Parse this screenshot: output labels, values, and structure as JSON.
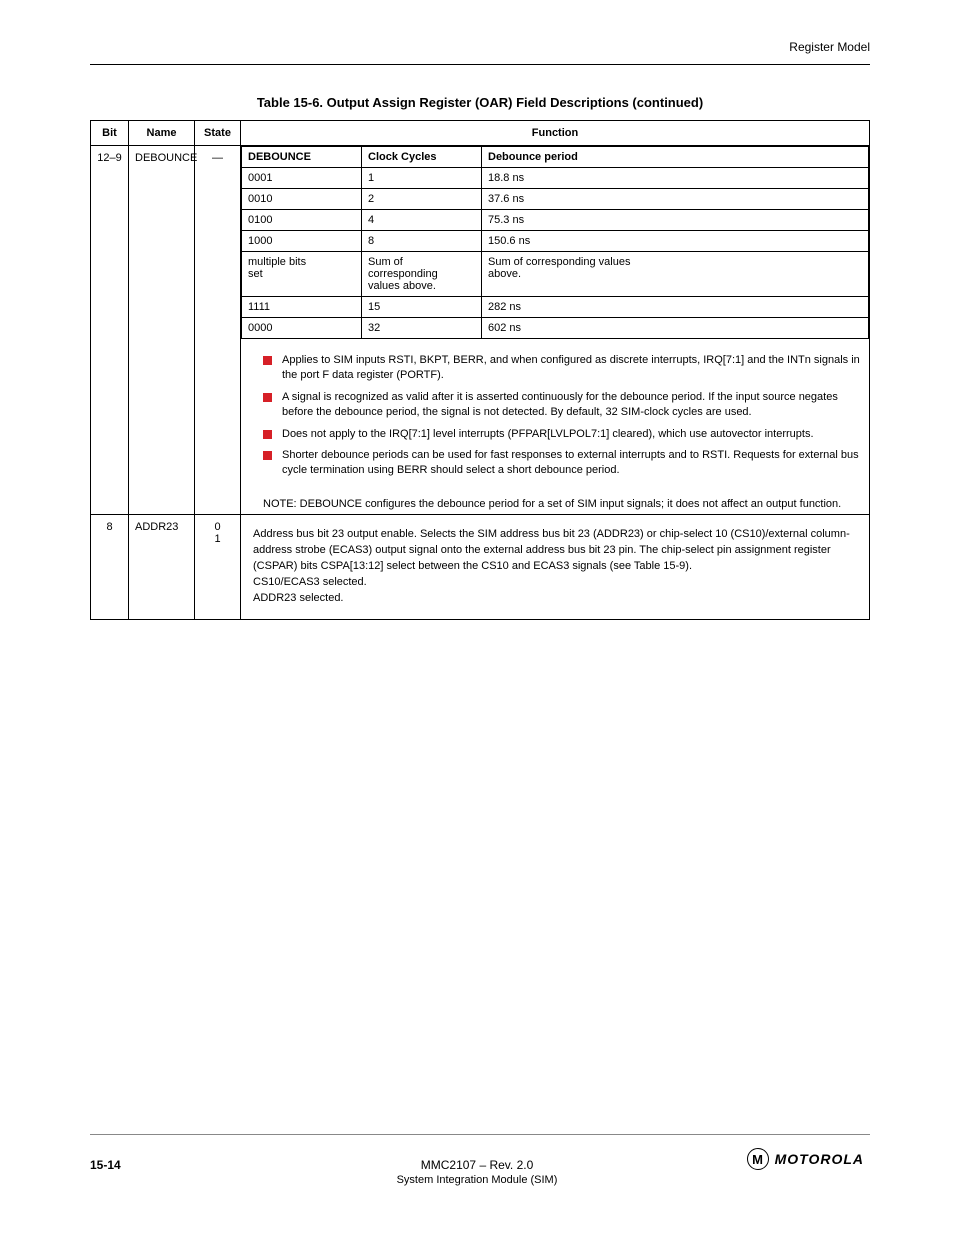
{
  "header": {
    "running": "Register Model"
  },
  "caption": "Table 15-6. Output Assign Register (OAR) Field Descriptions (continued)",
  "columns": {
    "bit": "Bit",
    "name": "Name",
    "state": "State",
    "func": "Function"
  },
  "row1": {
    "bit": "12–9",
    "name": "DEBOUNCE",
    "state": "—",
    "inner": {
      "head": {
        "a": "DEBOUNCE",
        "b": "Clock Cycles",
        "c": "Debounce period"
      },
      "rows": [
        {
          "a": "0001",
          "b": "1",
          "c": "18.8 ns"
        },
        {
          "a": "0010",
          "b": "2",
          "c": "37.6 ns"
        },
        {
          "a": "0100",
          "b": "4",
          "c": "75.3 ns"
        },
        {
          "a": "1000",
          "b": "8",
          "c": "150.6 ns"
        },
        {
          "a": "multiple bits\nset",
          "b": "Sum of\ncorresponding\nvalues above.",
          "c": "Sum of corresponding values\nabove."
        },
        {
          "a": "1111",
          "b": "15",
          "c": "282 ns"
        },
        {
          "a": "0000",
          "b": "32",
          "c": "602 ns"
        }
      ]
    },
    "bullets": [
      "Applies to SIM inputs RSTI, BKPT, BERR, and when configured as discrete interrupts, IRQ[7:1] and the INTn signals in the port F data register (PORTF).",
      "A signal is recognized as valid after it is asserted continuously for the debounce period. If the input source negates before the debounce period, the signal is not detected. By default, 32 SIM-clock cycles are used.",
      "Does not apply to the IRQ[7:1] level interrupts (PFPAR[LVLPOL7:1] cleared), which use autovector interrupts.",
      "Shorter debounce periods can be used for fast responses to external interrupts and to RSTI. Requests for external bus cycle termination using BERR should select a short debounce period."
    ],
    "note": "NOTE: DEBOUNCE configures the debounce period for a set of SIM input signals; it does not affect an output function."
  },
  "row2": {
    "bit": "8",
    "name": "ADDR23",
    "state": "0\n1",
    "desc": "Address bus bit 23 output enable. Selects the SIM address bus bit 23 (ADDR23) or chip-select 10 (CS10)/external column-address strobe (ECAS3) output signal onto the external address bus bit 23 pin. The chip-select pin assignment register (CSPAR) bits CSPA[13:12] select between the CS10 and ECAS3 signals (see Table 15-9).\nCS10/ECAS3 selected.\nADDR23 selected."
  },
  "footer": {
    "page": "15-14",
    "title": "MMC2107 – Rev. 2.0",
    "subtitle_left": "System Integration Module (SIM)",
    "brand": "MOTOROLA"
  }
}
